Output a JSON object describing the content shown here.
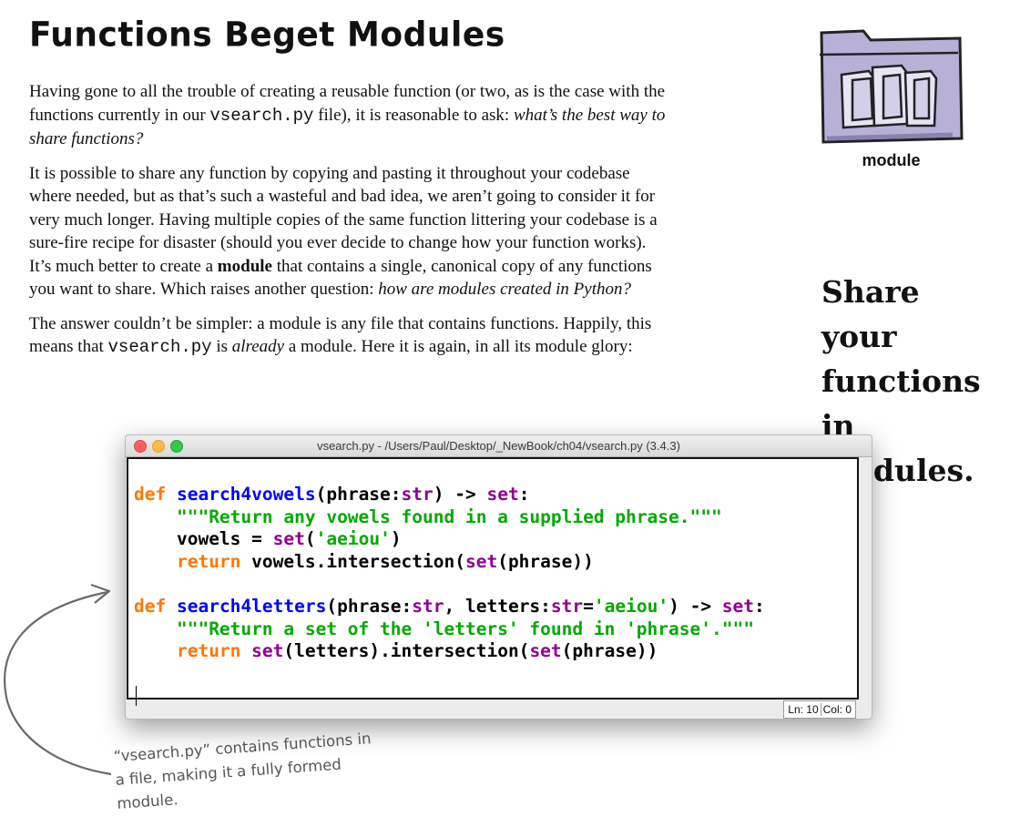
{
  "title": "Functions Beget Modules",
  "paragraphs": {
    "p1": {
      "a": "Having gone to all the trouble of creating a reusable function (or two, as is the case with the functions currently in our ",
      "code": "vsearch.py",
      "b": " file), it is reasonable to ask: ",
      "em": "what’s the best way to share functions?"
    },
    "p2": {
      "a": "It is possible to share any function by copying and pasting it throughout your codebase where needed, but as that’s such a wasteful and bad idea, we aren’t going to consider it for very much longer. Having multiple copies of the same function littering your codebase is a sure-fire recipe for disaster (should you ever decide to change how your function works). It’s much better to create a ",
      "strong": "module",
      "b": " that contains a single, canonical copy of any functions you want to share. Which raises another question: ",
      "em": "how are modules created in Python?"
    },
    "p3": {
      "a": "The answer couldn’t be simpler: a module is any file that contains functions. Happily, this means that ",
      "code": "vsearch.py",
      "b": " is ",
      "em": "already",
      "c": " a module. Here it is again, in all its module glory:"
    }
  },
  "sidebar": {
    "module_caption": "module",
    "share_lines": [
      "Share your",
      "functions",
      "in modules."
    ]
  },
  "window": {
    "title": "vsearch.py - /Users/Paul/Desktop/_NewBook/ch04/vsearch.py (3.4.3)",
    "code": {
      "l1": {
        "kw": "def",
        "name": "search4vowels",
        "p1": "(phrase:",
        "t1": "str",
        "p2": ") -> ",
        "t2": "set",
        "p3": ":"
      },
      "l2": {
        "indent": "    ",
        "doc": "\"\"\"Return any vowels found in a supplied phrase.\"\"\""
      },
      "l3": {
        "indent": "    ",
        "a": "vowels = ",
        "bi": "set",
        "p1": "(",
        "s": "'aeiou'",
        "p2": ")"
      },
      "l4": {
        "indent": "    ",
        "kw": "return",
        "a": " vowels.intersection(",
        "bi": "set",
        "b": "(phrase))"
      },
      "l6": {
        "kw": "def",
        "name": "search4letters",
        "p1": "(phrase:",
        "t1": "str",
        "p2": ", letters:",
        "t2": "str",
        "p3": "=",
        "s": "'aeiou'",
        "p4": ") -> ",
        "t3": "set",
        "p5": ":"
      },
      "l7": {
        "indent": "    ",
        "doc": "\"\"\"Return a set of the 'letters' found in 'phrase'.\"\"\""
      },
      "l8": {
        "indent": "    ",
        "kw": "return",
        "sp": " ",
        "bi1": "set",
        "a": "(letters).intersection(",
        "bi2": "set",
        "b": "(phrase))"
      }
    },
    "status": {
      "ln": "Ln: 10",
      "col": "Col: 0"
    }
  },
  "annotation": {
    "lines": [
      "“vsearch.py” contains functions in",
      "a file, making it a fully formed",
      "module."
    ]
  },
  "colors": {
    "keyword": "#ff7700",
    "definition": "#0000ff",
    "builtin": "#900090",
    "string": "#00aa00",
    "folder": "#b9b0d8"
  },
  "icons": {
    "module": "folder-with-documents-icon",
    "annotation_arrow": "curved-arrow-icon"
  }
}
